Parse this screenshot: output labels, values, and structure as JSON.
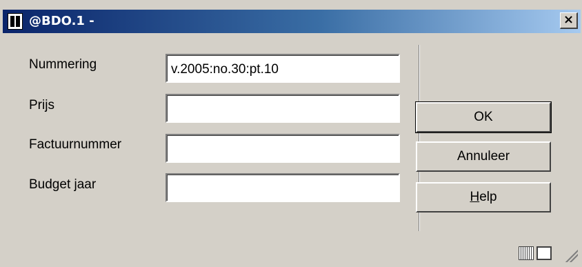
{
  "window": {
    "title": "@BDO.1 -",
    "close_label": "×"
  },
  "form": {
    "fields": [
      {
        "label": "Nummering",
        "value": "v.2005:no.30:pt.10"
      },
      {
        "label": "Prijs",
        "value": ""
      },
      {
        "label": "Factuurnummer",
        "value": ""
      },
      {
        "label": "Budget jaar",
        "value": ""
      }
    ]
  },
  "buttons": {
    "ok": "OK",
    "cancel": "Annuleer",
    "help": "Help"
  },
  "status": {
    "icons": [
      "keyboard-icon",
      "expand-icon",
      "resize-grip-icon"
    ]
  }
}
